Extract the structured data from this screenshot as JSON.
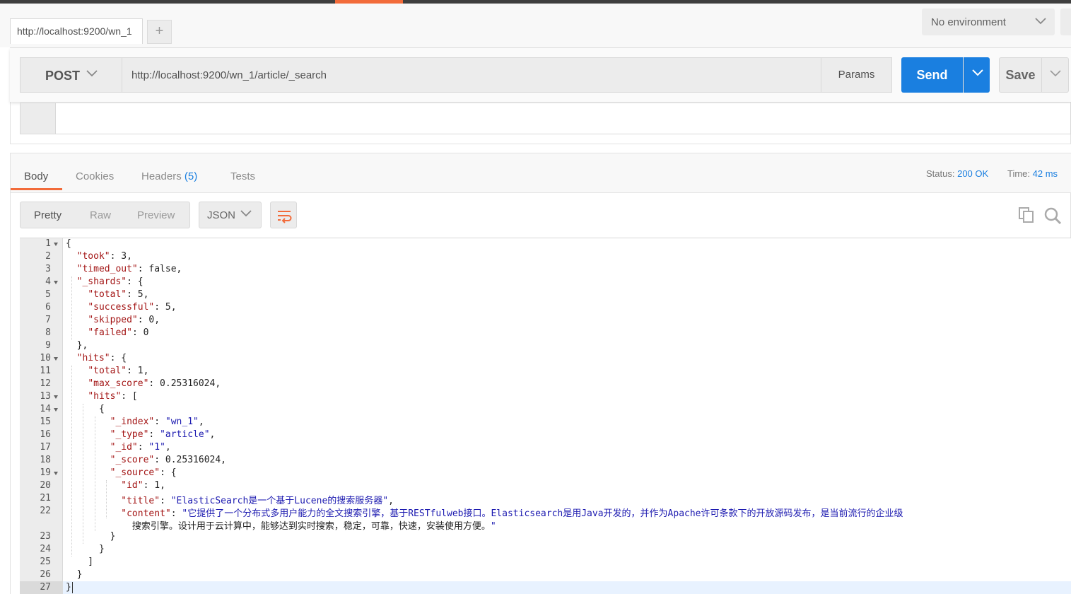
{
  "tab": {
    "title": "http://localhost:9200/wn_1"
  },
  "environment": {
    "selected": "No environment"
  },
  "request": {
    "method": "POST",
    "url": "http://localhost:9200/wn_1/article/_search",
    "params_label": "Params",
    "send_label": "Send",
    "save_label": "Save"
  },
  "response": {
    "tabs": {
      "body": "Body",
      "cookies": "Cookies",
      "headers": "Headers",
      "headers_count": "(5)",
      "tests": "Tests"
    },
    "status_label": "Status:",
    "status_value": "200 OK",
    "time_label": "Time:",
    "time_value": "42 ms",
    "views": {
      "pretty": "Pretty",
      "raw": "Raw",
      "preview": "Preview"
    },
    "format": "JSON"
  },
  "code_lines": [
    "{",
    "  \"took\": 3,",
    "  \"timed_out\": false,",
    "  \"_shards\": {",
    "    \"total\": 5,",
    "    \"successful\": 5,",
    "    \"skipped\": 0,",
    "    \"failed\": 0",
    "  },",
    "  \"hits\": {",
    "    \"total\": 1,",
    "    \"max_score\": 0.25316024,",
    "    \"hits\": [",
    "      {",
    "        \"_index\": \"wn_1\",",
    "        \"_type\": \"article\",",
    "        \"_id\": \"1\",",
    "        \"_score\": 0.25316024,",
    "        \"_source\": {",
    "          \"id\": 1,",
    "          \"title\": \"ElasticSearch是一个基于Lucene的搜索服务器\",",
    "          \"content\": \"它提供了一个分布式多用户能力的全文搜索引擎，基于RESTfulweb接口。Elasticsearch是用Java开发的，并作为Apache许可条款下的开放源码发布，是当前流行的企业级",
    "            搜索引擎。设计用于云计算中，能够达到实时搜索，稳定，可靠，快速，安装使用方便。\"",
    "        }",
    "      }",
    "    ]",
    "  }",
    "}"
  ],
  "line_numbers": [
    "1",
    "2",
    "3",
    "4",
    "5",
    "6",
    "7",
    "8",
    "9",
    "10",
    "11",
    "12",
    "13",
    "14",
    "15",
    "16",
    "17",
    "18",
    "19",
    "20",
    "21",
    "22",
    "",
    "23",
    "24",
    "25",
    "26",
    "27"
  ],
  "colors": {
    "accent": "#f26b3a",
    "send": "#1a7fe0",
    "key": "#a31515",
    "string": "#1c1ab0"
  },
  "icons": [
    "plus-icon",
    "chevron-down-icon",
    "wrap-lines-icon",
    "copy-icon",
    "search-icon",
    "fold-arrow-icon"
  ]
}
